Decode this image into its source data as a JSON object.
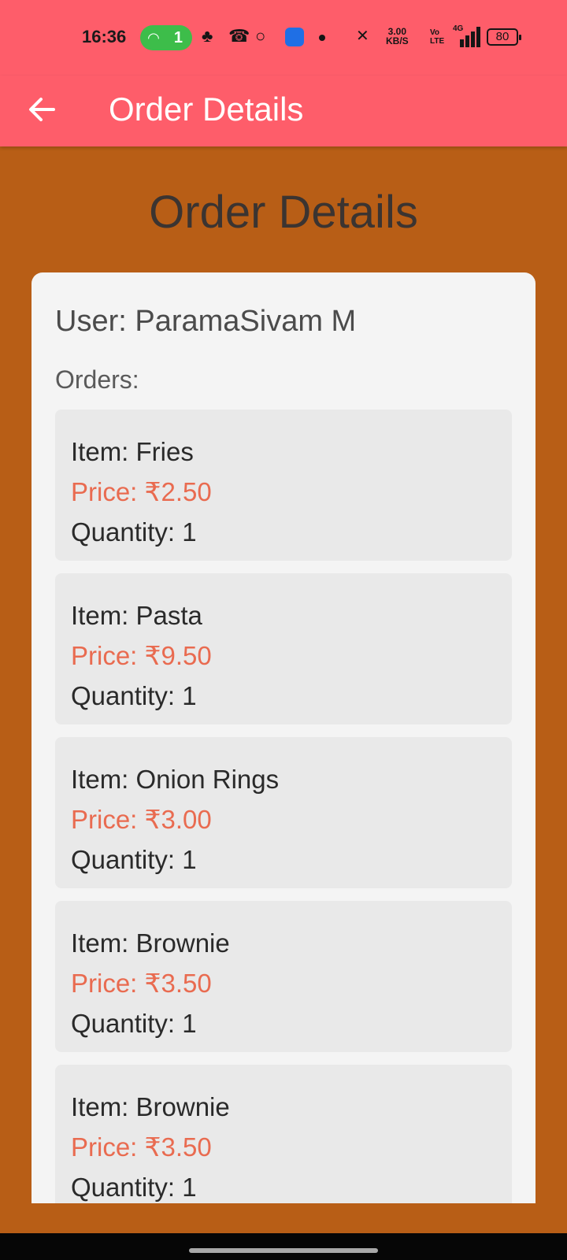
{
  "status_bar": {
    "time": "16:36",
    "hotspot_count": "1",
    "net_speed_value": "3.00",
    "net_speed_unit": "KB/S",
    "volte_top": "Vo",
    "volte_bottom": "LTE",
    "network": "4G",
    "battery": "80"
  },
  "app_bar": {
    "title": "Order Details",
    "back_icon": "arrow-left-icon"
  },
  "page": {
    "heading": "Order Details",
    "user_line": "User: ParamaSivam M",
    "orders_label": "Orders:"
  },
  "orders": [
    {
      "item": "Item: Fries",
      "price": "Price: ₹2.50",
      "quantity": "Quantity: 1"
    },
    {
      "item": "Item: Pasta",
      "price": "Price: ₹9.50",
      "quantity": "Quantity: 1"
    },
    {
      "item": "Item: Onion Rings",
      "price": "Price: ₹3.00",
      "quantity": "Quantity: 1"
    },
    {
      "item": "Item: Brownie",
      "price": "Price: ₹3.50",
      "quantity": "Quantity: 1"
    },
    {
      "item": "Item: Brownie",
      "price": "Price: ₹3.50",
      "quantity": "Quantity: 1"
    }
  ],
  "colors": {
    "app_bar": "#fe5d6a",
    "background": "#b85e16",
    "card": "#f4f4f4",
    "order_item": "#e9e9e9",
    "price_text": "#e96b50",
    "hotspot_pill": "#3dbd4a"
  }
}
